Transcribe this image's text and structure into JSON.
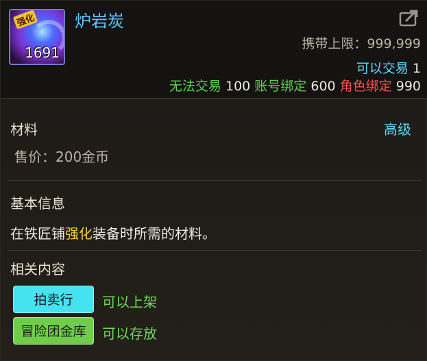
{
  "item": {
    "title": "炉岩炭",
    "icon_tag": "强化",
    "icon_count": "1691",
    "carry_limit": "携带上限：999,999",
    "trade_label": "可以交易",
    "trade_value": "1",
    "no_trade_label": "无法交易",
    "no_trade_value": "100",
    "account_bound_label": "账号绑定",
    "account_bound_value": "600",
    "char_bound_label": "角色绑定",
    "char_bound_value": "990"
  },
  "section_material": {
    "label": "材料",
    "grade": "高级",
    "price": "售价：200金币"
  },
  "section_basic": {
    "label": "基本信息",
    "desc_prefix": "在铁匠铺",
    "desc_highlight": "强化",
    "desc_suffix": "装备时所需的材料。"
  },
  "section_related": {
    "label": "相关内容",
    "auction_button": "拍卖行",
    "auction_note": "可以上架",
    "bank_button": "冒险团金库",
    "bank_note": "可以存放"
  },
  "colors": {
    "title": "#5fc8ff",
    "cyan": "#5fd8ff",
    "green": "#5cd24a",
    "red": "#ff4d4d",
    "highlight": "#f7c93a",
    "auction_button": "#45e2f0",
    "bank_button": "#6fcd4a"
  },
  "icons": {
    "item_icon": "coal-orb-icon",
    "share_icon": "share-arrow-icon"
  }
}
